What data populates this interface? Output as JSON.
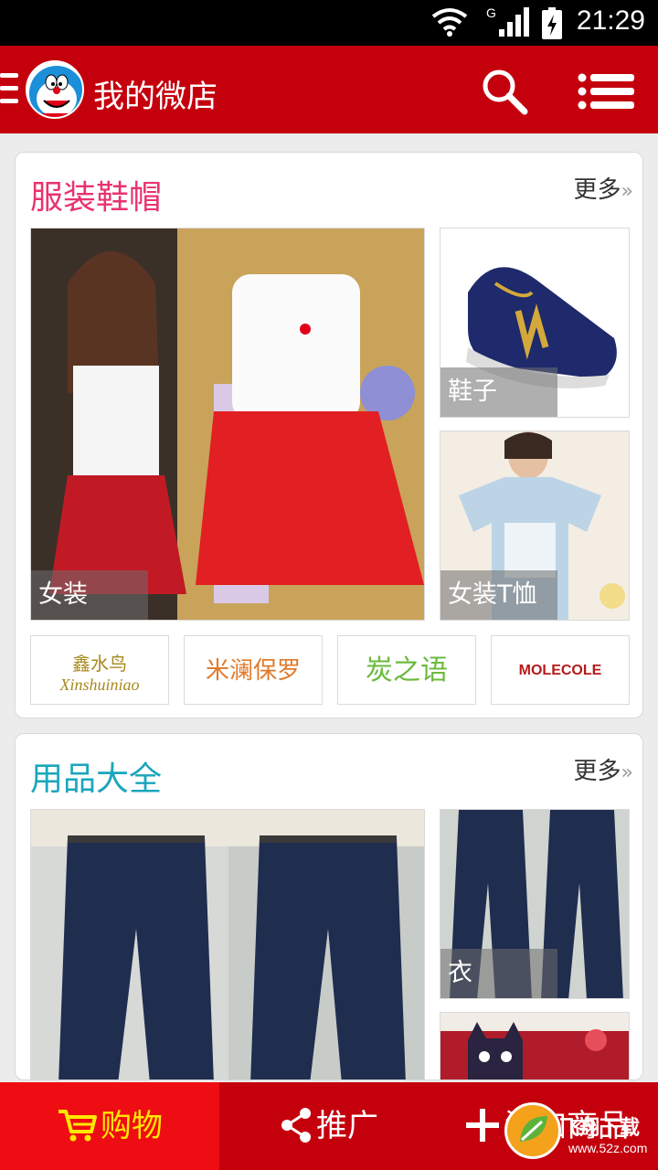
{
  "status_bar": {
    "time": "21:29",
    "network": "G"
  },
  "header": {
    "title": "我的微店"
  },
  "sections": [
    {
      "title": "服装鞋帽",
      "title_color": "#e8336d",
      "more": "更多",
      "more_glyph": "»",
      "tiles": [
        {
          "label": "女装",
          "image": "woman-in-white-top-red-skirt"
        },
        {
          "label": "鞋子",
          "image": "navy-sneaker-n-logo"
        },
        {
          "label": "女装T恤",
          "image": "woman-in-light-blue-tee"
        }
      ],
      "brands": [
        {
          "name": "鑫水鸟",
          "subtitle": "Xinshuiniao",
          "color": "#a8891e"
        },
        {
          "name": "米澜保罗",
          "color": "#e07a2b"
        },
        {
          "name": "炭之语",
          "color": "#6cba3f"
        },
        {
          "name": "MOLECOLE",
          "color": "#b51a1a"
        }
      ]
    },
    {
      "title": "用品大全",
      "title_color": "#1aa6bd",
      "more": "更多",
      "more_glyph": "»",
      "tiles": [
        {
          "label": "",
          "image": "dark-denim-jeans-front"
        },
        {
          "label": "衣",
          "image": "dark-denim-jeans-side"
        },
        {
          "label": "",
          "image": "cat-face-bag"
        }
      ]
    }
  ],
  "bottom_nav": {
    "shop": "购物",
    "share": "推广",
    "add": "添加商品"
  },
  "watermark": {
    "text": "飞翔下载",
    "url": "www.52z.com"
  },
  "colors": {
    "header_bg": "#c4000d",
    "shop_tab_bg": "#ee0d12",
    "shop_tab_fg": "#ffe800"
  }
}
